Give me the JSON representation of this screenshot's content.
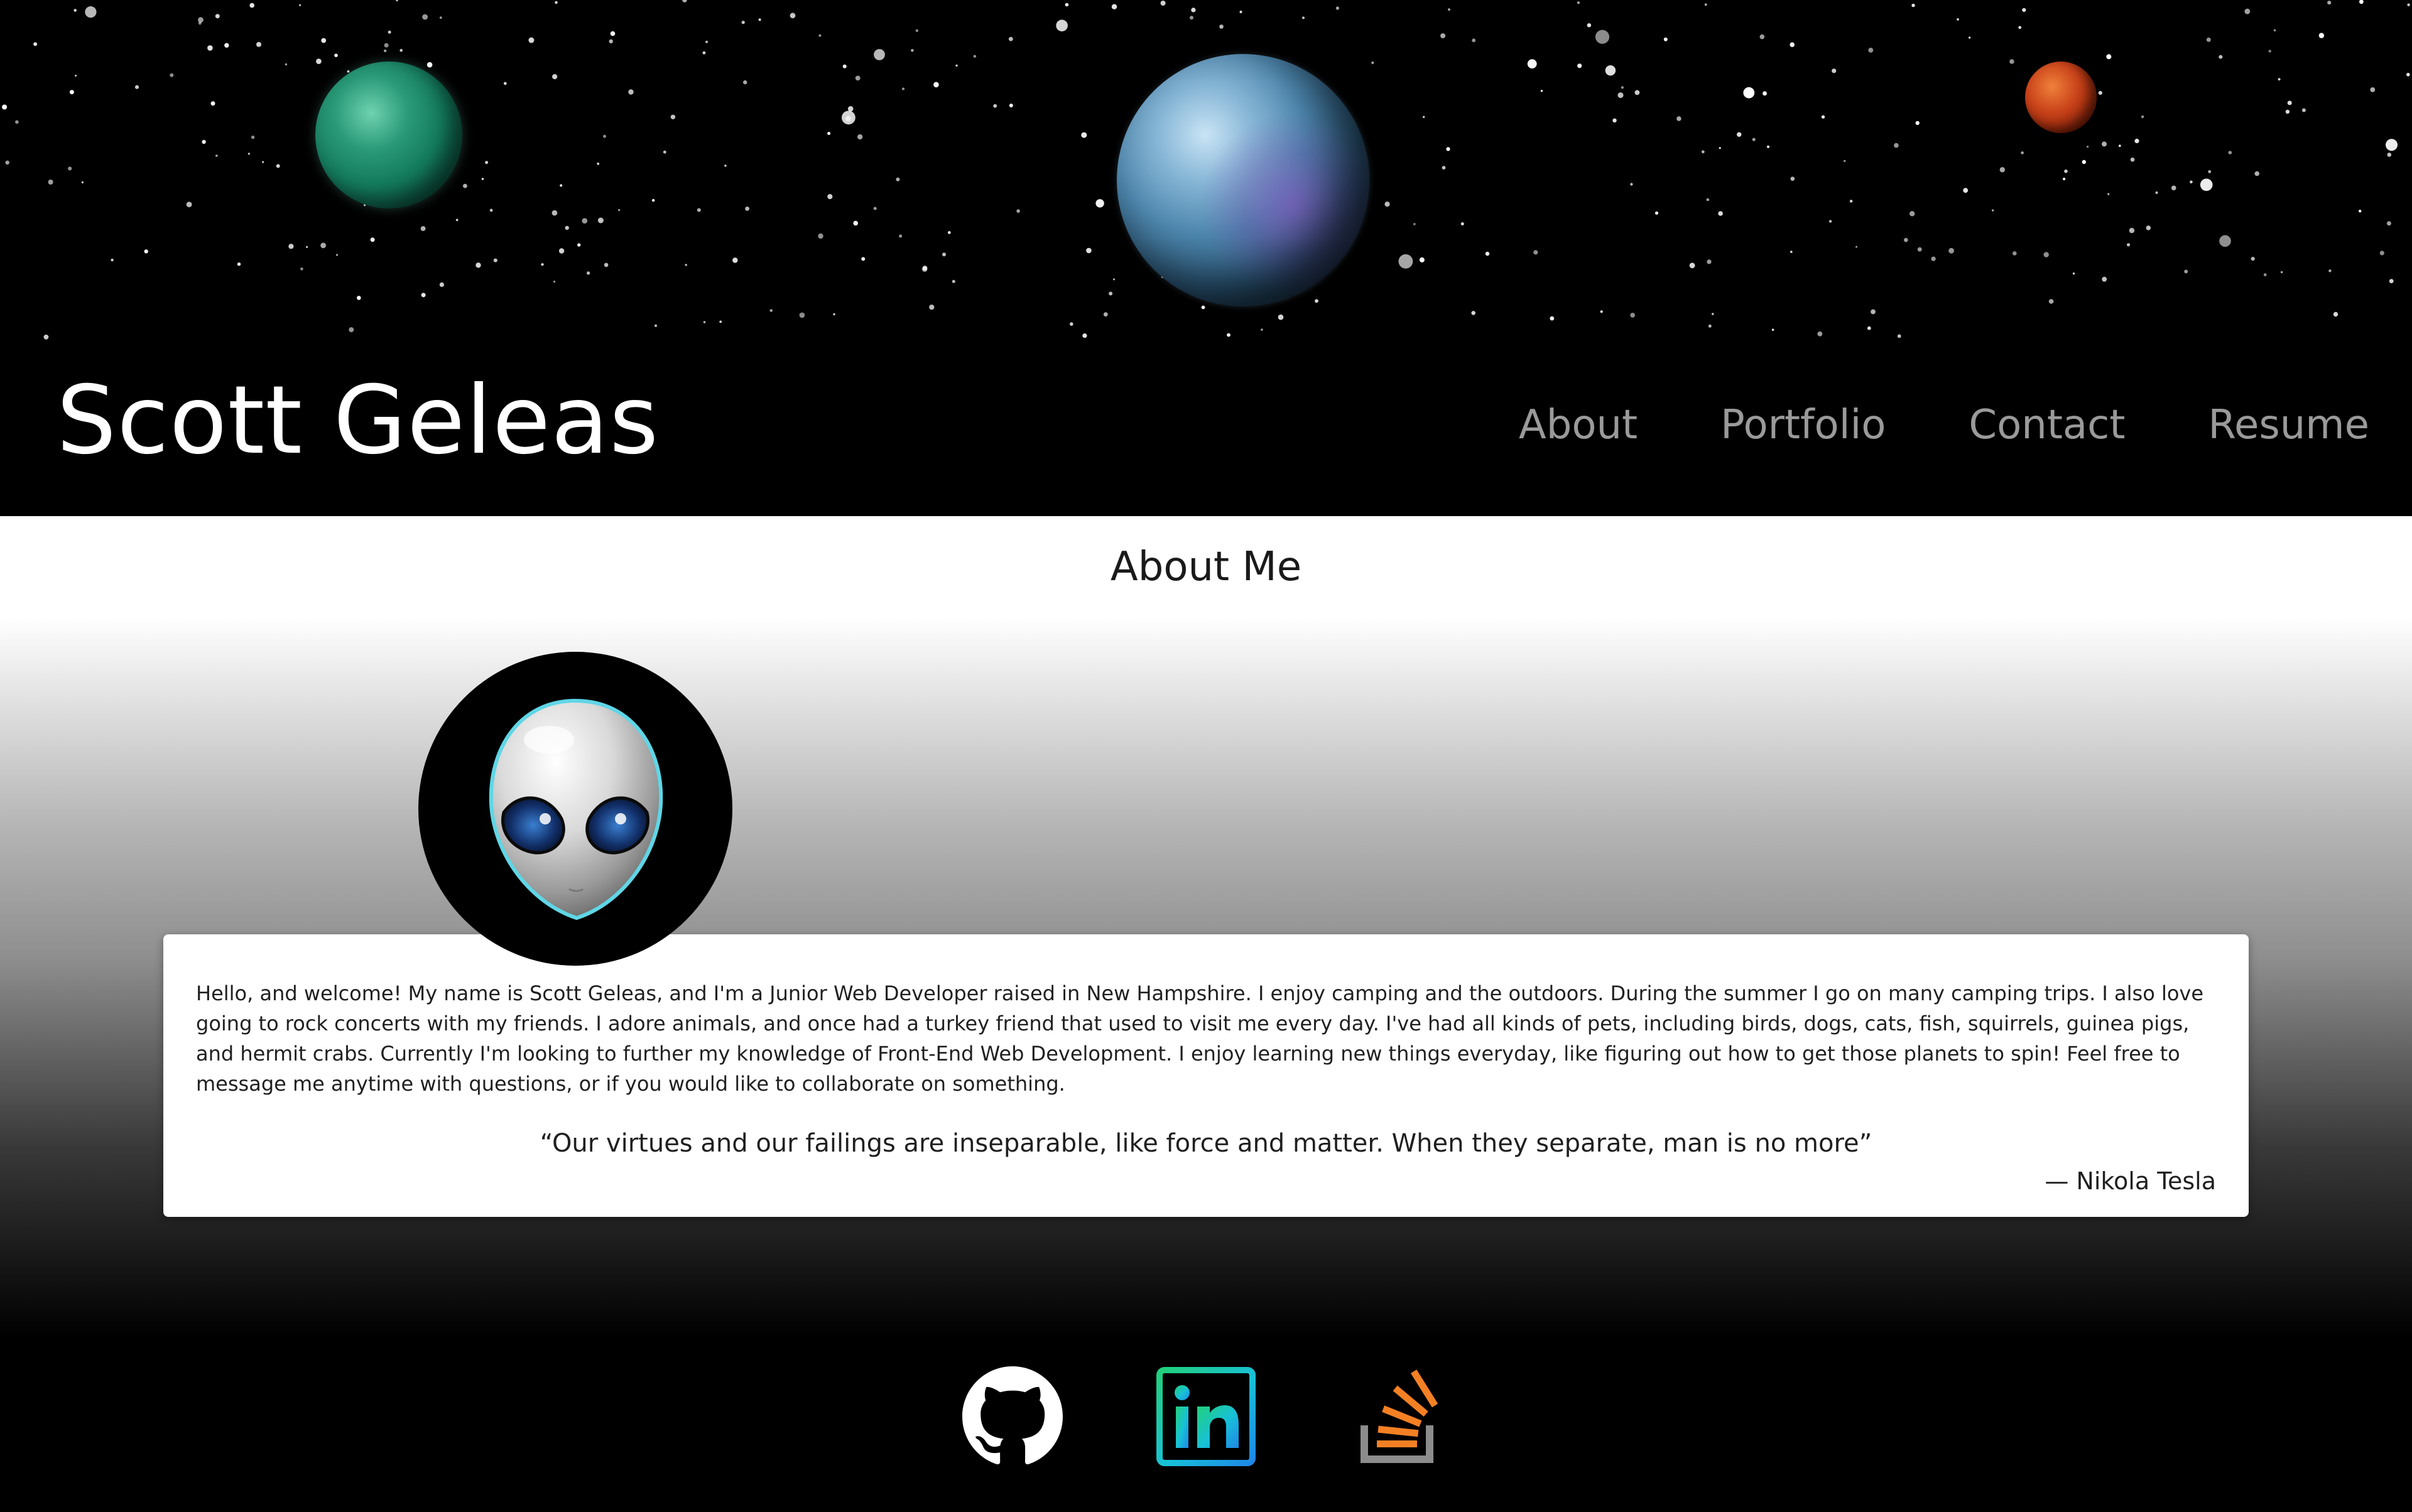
{
  "header": {
    "site_title": "Scott Geleas",
    "nav": [
      "About",
      "Portfolio",
      "Contact",
      "Resume"
    ]
  },
  "about": {
    "heading": "About Me",
    "bio": "Hello, and welcome! My name is Scott Geleas, and I'm a Junior Web Developer raised in New Hampshire. I enjoy camping and the outdoors. During the summer I go on many camping trips. I also love going to rock concerts with my friends. I adore animals, and once had a turkey friend that used to visit me every day. I've had all kinds of pets, including birds, dogs, cats, fish, squirrels, guinea pigs, and hermit crabs. Currently I'm looking to further my knowledge of Front-End Web Development. I enjoy learning new things everyday, like figuring out how to get those planets to spin! Feel free to message me anytime with questions, or if you would like to collaborate on something.",
    "quote": "“Our virtues and our failings are inseparable, like force and matter. When they separate, man is no more”",
    "quote_author": "— Nikola Tesla"
  },
  "footer": {
    "social": [
      {
        "icon": "github-icon",
        "color": "#ffffff"
      },
      {
        "icon": "linkedin-icon",
        "color": "#1ec8e8"
      },
      {
        "icon": "stackoverflow-icon",
        "color": "#f48024"
      }
    ]
  },
  "colors": {
    "background": "#000000",
    "nav_text": "#9a9a9a",
    "title_text": "#ffffff",
    "card_background": "#ffffff"
  }
}
